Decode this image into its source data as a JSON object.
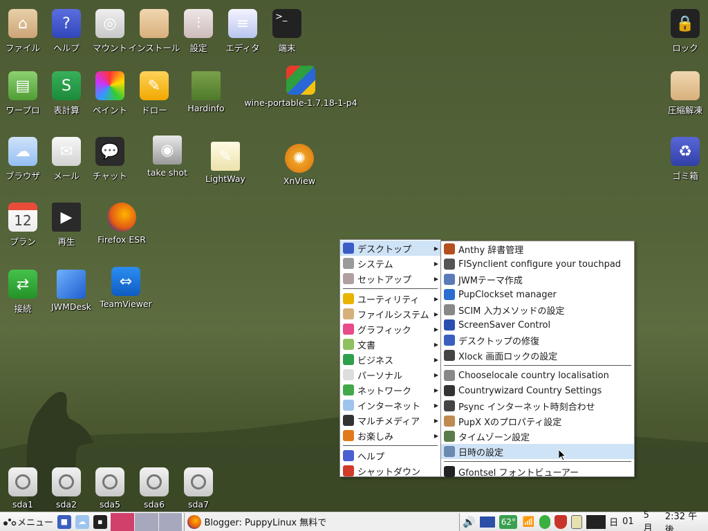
{
  "desktop": {
    "icons": [
      {
        "label": "ファイル",
        "icon": "home-folder-icon"
      },
      {
        "label": "ヘルプ",
        "icon": "help-icon"
      },
      {
        "label": "マウント",
        "icon": "mount-drive-icon"
      },
      {
        "label": "インストール",
        "icon": "install-box-icon"
      },
      {
        "label": "設定",
        "icon": "settings-sliders-icon"
      },
      {
        "label": "エディタ",
        "icon": "text-editor-icon"
      },
      {
        "label": "端末",
        "icon": "terminal-icon"
      },
      {
        "label": "ワープロ",
        "icon": "word-processor-icon"
      },
      {
        "label": "表計算",
        "icon": "spreadsheet-icon"
      },
      {
        "label": "ペイント",
        "icon": "paint-icon"
      },
      {
        "label": "ドロー",
        "icon": "draw-icon"
      },
      {
        "label": "Hardinfo",
        "icon": "hardinfo-icon"
      },
      {
        "label": "wine-portable-1.7.18-1-p4",
        "icon": "wine-icon"
      },
      {
        "label": "ブラウザ",
        "icon": "browser-cloud-icon"
      },
      {
        "label": "メール",
        "icon": "mail-icon"
      },
      {
        "label": "チャット",
        "icon": "chat-icon"
      },
      {
        "label": "take shot",
        "icon": "camera-icon"
      },
      {
        "label": "LightWay",
        "icon": "notepad-icon"
      },
      {
        "label": "XnView",
        "icon": "xnview-icon"
      },
      {
        "label": "プラン",
        "icon": "calendar-icon"
      },
      {
        "label": "再生",
        "icon": "clapperboard-icon"
      },
      {
        "label": "Firefox ESR",
        "icon": "firefox-icon"
      },
      {
        "label": "接続",
        "icon": "connect-icon"
      },
      {
        "label": "JWMDesk",
        "icon": "jwmdesk-icon"
      },
      {
        "label": "TeamViewer",
        "icon": "teamviewer-icon"
      },
      {
        "label": "ロック",
        "icon": "lock-icon"
      },
      {
        "label": "圧縮解凍",
        "icon": "archive-icon"
      },
      {
        "label": "ゴミ箱",
        "icon": "trash-icon"
      }
    ],
    "calendar_day": "12",
    "terminal_glyph": ">_",
    "drives": [
      "sda1",
      "sda2",
      "sda5",
      "sda6",
      "sda7"
    ]
  },
  "main_menu": {
    "items": [
      {
        "label": "デスクトップ",
        "submenu": true,
        "active": true
      },
      {
        "label": "システム",
        "submenu": true
      },
      {
        "label": "セットアップ",
        "submenu": true
      },
      {
        "label": "ユーティリティ",
        "submenu": true
      },
      {
        "label": "ファイルシステム",
        "submenu": true
      },
      {
        "label": "グラフィック",
        "submenu": true
      },
      {
        "label": "文書",
        "submenu": true
      },
      {
        "label": "ビジネス",
        "submenu": true
      },
      {
        "label": "パーソナル",
        "submenu": true
      },
      {
        "label": "ネットワーク",
        "submenu": true
      },
      {
        "label": "インターネット",
        "submenu": true
      },
      {
        "label": "マルチメディア",
        "submenu": true
      },
      {
        "label": "お楽しみ",
        "submenu": true
      },
      {
        "label": "ヘルプ",
        "submenu": false
      },
      {
        "label": "シャットダウン",
        "submenu": false
      }
    ]
  },
  "desktop_submenu": {
    "items": [
      {
        "label": "Anthy 辞書管理"
      },
      {
        "label": "FISynclient configure your touchpad"
      },
      {
        "label": "JWMテーマ作成"
      },
      {
        "label": "PupClockset manager"
      },
      {
        "label": "SCIM 入力メソッドの設定"
      },
      {
        "label": "ScreenSaver Control"
      },
      {
        "label": "デスクトップの修復"
      },
      {
        "label": "Xlock 画面ロックの設定"
      },
      {
        "label": "Chooselocale country localisation"
      },
      {
        "label": "Countrywizard Country Settings"
      },
      {
        "label": "Psync インターネット時刻合わせ"
      },
      {
        "label": "PupX Xのプロパティ設定"
      },
      {
        "label": "タイムゾーン設定"
      },
      {
        "label": "日時の設定",
        "active": true
      },
      {
        "label": "Gfontsel フォントビューアー"
      }
    ]
  },
  "taskbar": {
    "menu_label": "メニュー",
    "window_title": "Blogger: PuppyLinux 無料で",
    "temperature": "62°",
    "day_label": "日",
    "date_day": "01",
    "month": "5月",
    "time": "2:32 午後"
  },
  "colors": {
    "menu_highlight": "#cfe3f7",
    "taskbar_pager_active": "#d0406a",
    "temperature_bg": "#3aa050"
  }
}
